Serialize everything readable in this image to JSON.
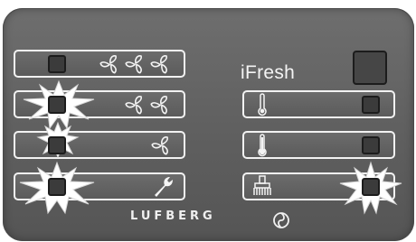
{
  "panel": {
    "ifresh_label": "iFresh",
    "brand_label": "LUFBERG",
    "colors": {
      "panel": "#636363",
      "outline": "#f2f2f2",
      "led": "#3b3b3b",
      "flash": "#ffffff"
    }
  },
  "left_keys": [
    {
      "name": "fan-speed-high",
      "icon": "fan-icon x3",
      "flashing": false
    },
    {
      "name": "fan-speed-medium",
      "icon": "fan-icon x2",
      "flashing": true
    },
    {
      "name": "fan-speed-low",
      "icon": "fan-icon x1",
      "flashing": true
    },
    {
      "name": "service",
      "icon": "wrench-icon",
      "flashing": true
    }
  ],
  "right_keys": [
    {
      "name": "ifresh",
      "icon": "none",
      "flashing": false
    },
    {
      "name": "temperature-low",
      "icon": "thermometer-low-icon",
      "flashing": false
    },
    {
      "name": "temperature-high",
      "icon": "thermometer-high-icon",
      "flashing": false
    },
    {
      "name": "filter-cleaning",
      "icon": "brush-icon",
      "flashing": true
    }
  ]
}
